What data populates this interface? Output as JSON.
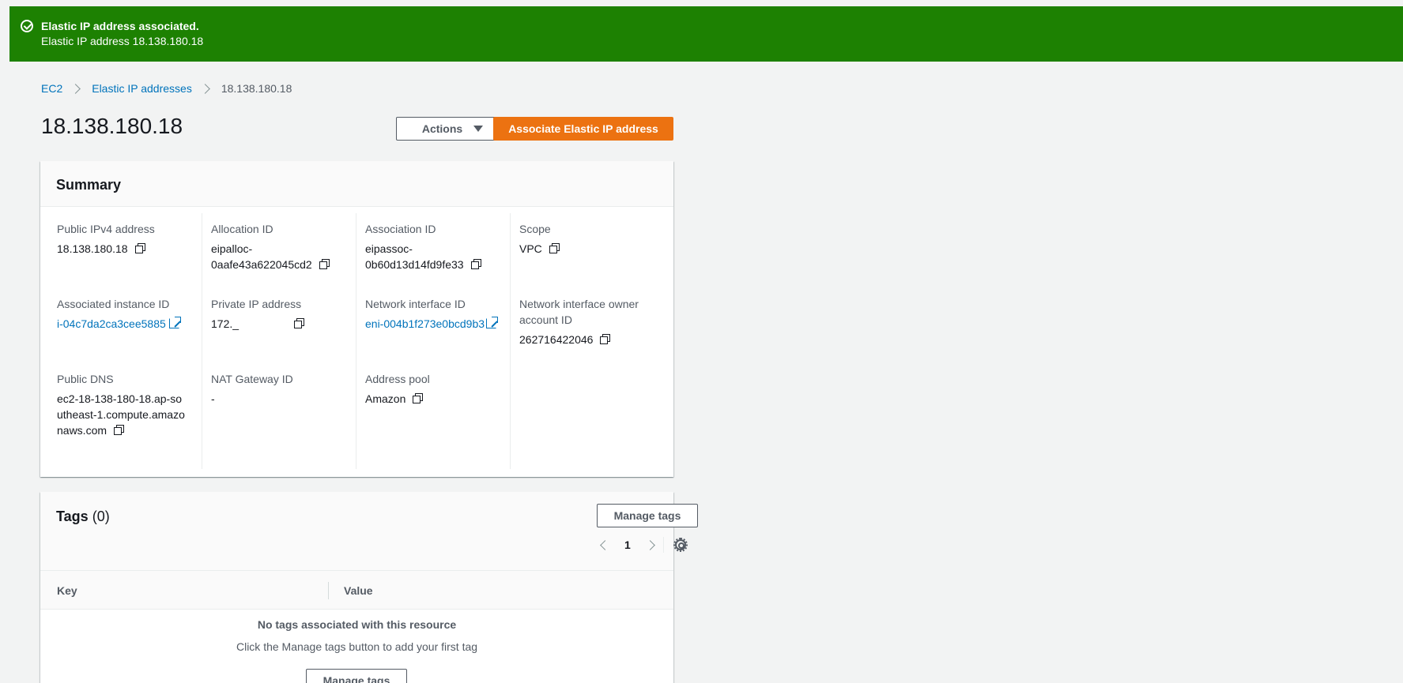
{
  "flash": {
    "title": "Elastic IP address associated.",
    "message": "Elastic IP address 18.138.180.18"
  },
  "breadcrumb": {
    "items": [
      "EC2",
      "Elastic IP addresses"
    ],
    "current": "18.138.180.18"
  },
  "page_title": "18.138.180.18",
  "header_buttons": {
    "actions": "Actions",
    "associate": "Associate Elastic IP address"
  },
  "summary": {
    "title": "Summary",
    "fields": {
      "public_ipv4": {
        "label": "Public IPv4 address",
        "value": "18.138.180.18"
      },
      "allocation_id": {
        "label": "Allocation ID",
        "value": "eipalloc-0aafe43a622045cd2"
      },
      "association_id": {
        "label": "Association ID",
        "value": "eipassoc-0b60d13d14fd9fe33"
      },
      "scope": {
        "label": "Scope",
        "value": "VPC"
      },
      "instance_id": {
        "label": "Associated instance ID",
        "value": "i-04c7da2ca3cee5885"
      },
      "private_ip": {
        "label": "Private IP address",
        "value": "172._"
      },
      "eni_id": {
        "label": "Network interface ID",
        "value": "eni-004b1f273e0bcd9b3"
      },
      "eni_owner": {
        "label": "Network interface owner account ID",
        "value": "262716422046"
      },
      "public_dns": {
        "label": "Public DNS",
        "value": "ec2-18-138-180-18.ap-southeast-1.compute.amazonaws.com"
      },
      "nat_gateway": {
        "label": "NAT Gateway ID",
        "value": "-"
      },
      "address_pool": {
        "label": "Address pool",
        "value": "Amazon"
      }
    }
  },
  "tags": {
    "title": "Tags",
    "count": "(0)",
    "manage_button": "Manage tags",
    "page": "1",
    "columns": {
      "key": "Key",
      "value": "Value"
    },
    "empty_title": "No tags associated with this resource",
    "empty_hint": "Click the Manage tags button to add your first tag",
    "empty_button": "Manage tags"
  }
}
